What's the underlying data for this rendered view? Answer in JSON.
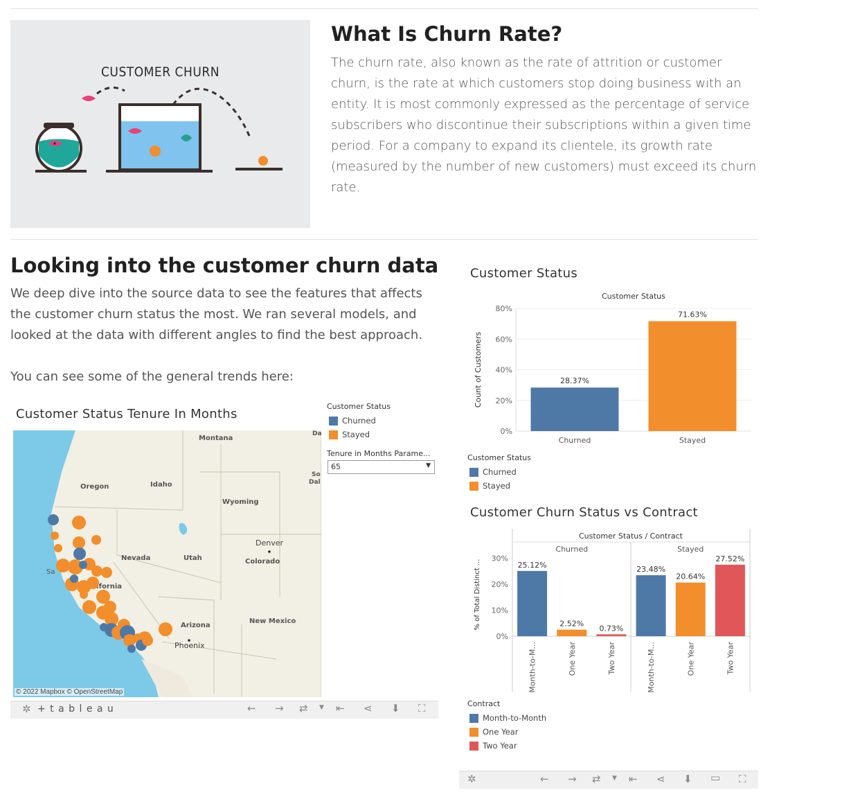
{
  "hero": {
    "image_caption": "CUSTOMER CHURN"
  },
  "what_is": {
    "title": "What Is Churn Rate?",
    "text": "The churn rate, also known as the rate of attrition or customer churn, is the rate at which customers stop doing business with an entity. It is most commonly expressed as the percentage of service subscribers who discontinue their subscriptions within a given time period. For a company to expand its clientele, its growth rate (measured by the number of new customers) must exceed its churn rate."
  },
  "looking": {
    "title": "Looking into the customer churn data",
    "text": "We deep dive into the source data to see the features that affects the customer churn status the most. We ran several models, and looked at the data with different angles to find the best approach.",
    "trends": "You can see some of the general trends here:"
  },
  "map_viz": {
    "title": "Customer Status Tenure In Months",
    "legend_title": "Customer Status",
    "legend": [
      {
        "label": "Churned",
        "color": "#4e79a7"
      },
      {
        "label": "Stayed",
        "color": "#f28e2b"
      }
    ],
    "param_label": "Tenure in Months Parame...",
    "param_value": "65",
    "state_labels": [
      "Montana",
      "Oregon",
      "Idaho",
      "Wyoming",
      "Nevada",
      "Utah",
      "Colorado",
      "Arizona",
      "New Mexico",
      "alifornia",
      "Sa",
      "So",
      "Dal",
      "Da"
    ],
    "city_labels": [
      "Denver",
      "Phoenix"
    ],
    "attribution": "© 2022 Mapbox  © OpenStreetMap",
    "tableau_logo": "+ t a b l e a u"
  },
  "status_viz": {
    "title": "Customer Status",
    "legend_title": "Customer Status",
    "legend": [
      {
        "label": "Churned",
        "color": "#4e79a7"
      },
      {
        "label": "Stayed",
        "color": "#f28e2b"
      }
    ]
  },
  "contract_viz": {
    "title": "Customer Churn Status vs Contract",
    "legend_title": "Contract",
    "legend": [
      {
        "label": "Month-to-Month",
        "color": "#4e79a7"
      },
      {
        "label": "One Year",
        "color": "#f28e2b"
      },
      {
        "label": "Two Year",
        "color": "#e15759"
      }
    ]
  },
  "chart_data": [
    {
      "type": "bar",
      "title": "Customer Status",
      "ylabel": "Count of Customers",
      "categories": [
        "Churned",
        "Stayed"
      ],
      "values": [
        28.37,
        71.63
      ],
      "data_labels": [
        "28.37%",
        "71.63%"
      ],
      "colors": [
        "#4e79a7",
        "#f28e2b"
      ],
      "yticks": [
        "80%",
        "60%",
        "40%",
        "20%",
        "0%"
      ],
      "ylim": [
        0,
        80
      ]
    },
    {
      "type": "bar",
      "title": "Customer Status / Contract",
      "ylabel": "% of Total Distinct ...",
      "groups": [
        "Churned",
        "Stayed"
      ],
      "categories": [
        "Month-to-M...",
        "One Year",
        "Two Year"
      ],
      "series": [
        {
          "group": "Churned",
          "values": [
            25.12,
            2.52,
            0.73
          ],
          "labels": [
            "25.12%",
            "2.52%",
            "0.73%"
          ]
        },
        {
          "group": "Stayed",
          "values": [
            23.48,
            20.64,
            27.52
          ],
          "labels": [
            "23.48%",
            "20.64%",
            "27.52%"
          ]
        }
      ],
      "colors": [
        "#4e79a7",
        "#f28e2b",
        "#e15759"
      ],
      "yticks": [
        "30%",
        "20%",
        "10%",
        "0%"
      ],
      "ylim": [
        0,
        32
      ]
    }
  ]
}
